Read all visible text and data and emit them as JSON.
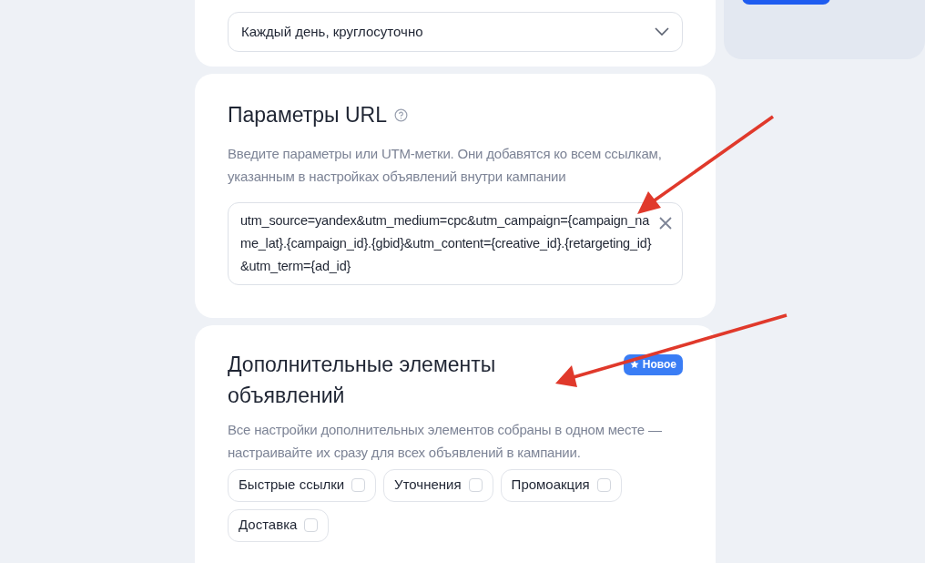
{
  "schedule": {
    "value": "Каждый день, круглосуточно"
  },
  "url_params": {
    "title": "Параметры URL",
    "description": "Введите параметры или UTM-метки. Они добавятся ко всем ссылкам, указанным в настройках объявлений внутри кампании",
    "value": "utm_source=yandex&utm_medium=cpc&utm_campaign={campaign_name_lat}.{campaign_id}.{gbid}&utm_content={creative_id}.{retargeting_id}&utm_term={ad_id}"
  },
  "extras": {
    "title": "Дополнительные элементы объявлений",
    "badge": "Новое",
    "description": "Все настройки дополнительных элементов собраны в одном месте — настраивайте их сразу для всех объявлений в кампании.",
    "options": [
      {
        "label": "Быстрые ссылки",
        "checked": false
      },
      {
        "label": "Уточнения",
        "checked": false
      },
      {
        "label": "Промоакция",
        "checked": false
      },
      {
        "label": "Доставка",
        "checked": false
      }
    ]
  }
}
